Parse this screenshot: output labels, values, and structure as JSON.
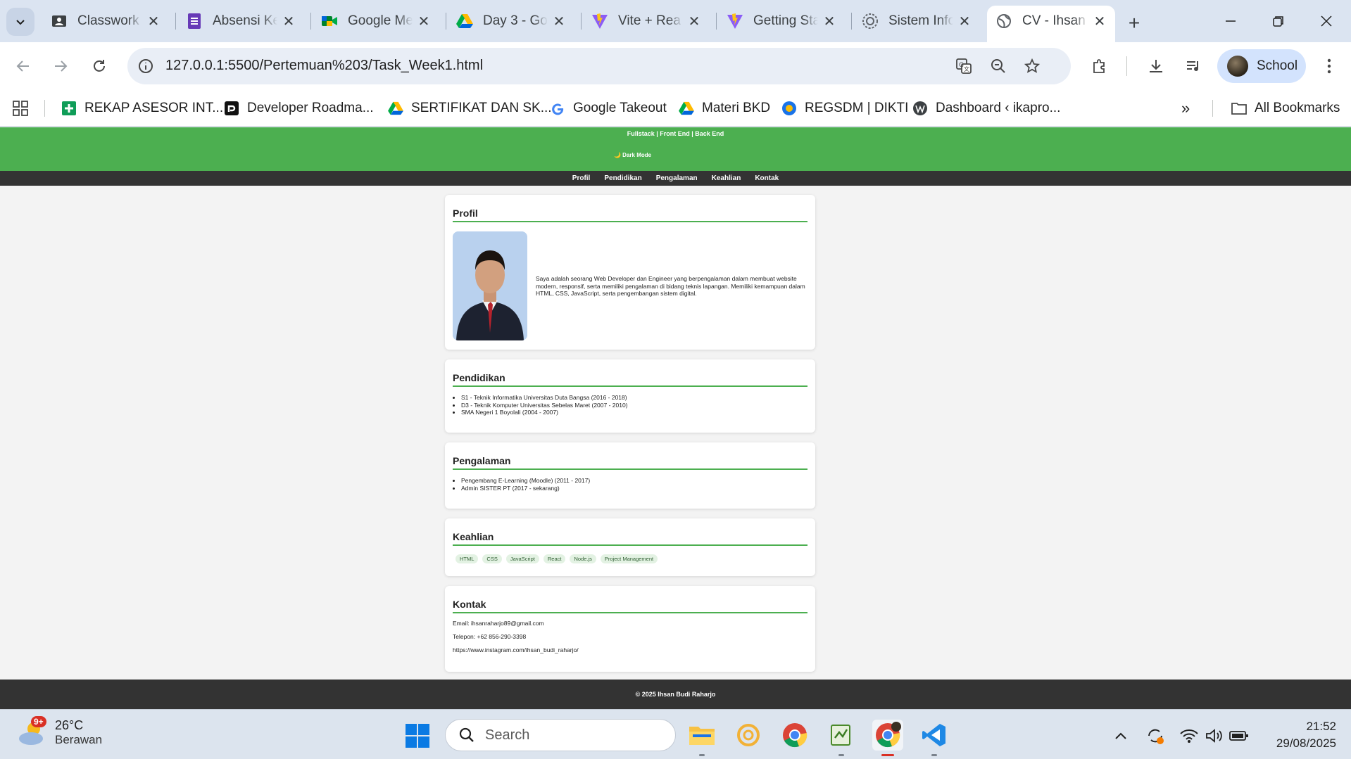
{
  "browser": {
    "tabs": [
      {
        "title": "Classwork",
        "icon": "classroom-icon"
      },
      {
        "title": "Absensi Ke",
        "icon": "forms-icon"
      },
      {
        "title": "Google Me",
        "icon": "meet-icon"
      },
      {
        "title": "Day 3 - Go",
        "icon": "drive-icon"
      },
      {
        "title": "Vite + Rea",
        "icon": "vite-icon"
      },
      {
        "title": "Getting Sta",
        "icon": "vite-icon"
      },
      {
        "title": "Sistem Info",
        "icon": "gear-seal-icon"
      },
      {
        "title": "CV - Ihsan",
        "icon": "globe-icon",
        "active": true
      }
    ],
    "url": "127.0.0.1:5500/Pertemuan%203/Task_Week1.html",
    "profile_label": "School",
    "bookmarks": [
      {
        "label": "REKAP ASESOR INT...",
        "icon": "sheets-icon"
      },
      {
        "label": "Developer Roadma...",
        "icon": "roadmap-icon"
      },
      {
        "label": "SERTIFIKAT DAN SK...",
        "icon": "drive-icon"
      },
      {
        "label": "Google Takeout",
        "icon": "google-icon"
      },
      {
        "label": "Materi BKD",
        "icon": "drive-icon"
      },
      {
        "label": "REGSDM | DIKTI",
        "icon": "dikti-icon"
      },
      {
        "label": "Dashboard ‹ ikapro...",
        "icon": "wordpress-icon"
      }
    ],
    "all_bookmarks": "All Bookmarks"
  },
  "site": {
    "subtitle": "Fullstack | Front End | Back End",
    "dark_mode": "🌙 Dark Mode",
    "nav": [
      "Profil",
      "Pendidikan",
      "Pengalaman",
      "Keahlian",
      "Kontak"
    ],
    "profil": {
      "heading": "Profil",
      "text": "Saya adalah seorang Web Developer dan Engineer yang berpengalaman dalam membuat website modern, responsif, serta memiliki pengalaman di bidang teknis lapangan. Memiliki kemampuan dalam HTML, CSS, JavaScript, serta pengembangan sistem digital."
    },
    "pendidikan": {
      "heading": "Pendidikan",
      "items": [
        "S1 - Teknik Informatika Universitas Duta Bangsa (2016 - 2018)",
        "D3 - Teknik Komputer Universitas Sebelas Maret (2007 - 2010)",
        "SMA Negeri 1 Boyolali (2004 - 2007)"
      ]
    },
    "pengalaman": {
      "heading": "Pengalaman",
      "items": [
        "Pengembang E-Learning (Moodle) (2011 - 2017)",
        "Admin SISTER PT (2017 - sekarang)"
      ]
    },
    "keahlian": {
      "heading": "Keahlian",
      "skills": [
        "HTML",
        "CSS",
        "JavaScript",
        "React",
        "Node.js",
        "Project Management"
      ]
    },
    "kontak": {
      "heading": "Kontak",
      "email": "Email: ihsanraharjo89@gmail.com",
      "phone": "Telepon: +62 856-290-3398",
      "instagram": "https://www.instagram.com/ihsan_budi_raharjo/"
    },
    "footer": "© 2025 Ihsan Budi Raharjo",
    "accent_color": "#4caf50",
    "nav_color": "#333333"
  },
  "taskbar": {
    "weather_temp": "26°C",
    "weather_desc": "Berawan",
    "weather_badge": "9+",
    "search_placeholder": "Search",
    "time": "21:52",
    "date": "29/08/2025"
  }
}
